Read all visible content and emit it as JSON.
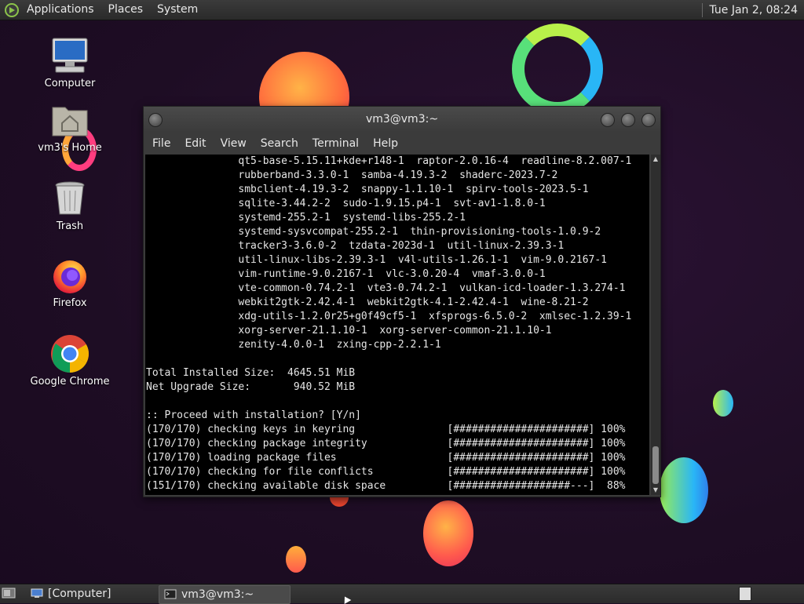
{
  "top_panel": {
    "menus": [
      "Applications",
      "Places",
      "System"
    ],
    "clock": "Tue Jan  2, 08:24"
  },
  "desktop_icons": [
    {
      "label": "Computer",
      "icon": "computer-icon"
    },
    {
      "label": "vm3's Home",
      "icon": "home-folder-icon"
    },
    {
      "label": "Trash",
      "icon": "trash-icon"
    },
    {
      "label": "Firefox",
      "icon": "firefox-icon"
    },
    {
      "label": "Google Chrome",
      "icon": "chrome-icon"
    }
  ],
  "terminal": {
    "title": "vm3@vm3:~",
    "menu": [
      "File",
      "Edit",
      "View",
      "Search",
      "Terminal",
      "Help"
    ],
    "lines": [
      "               qt5-base-5.15.11+kde+r148-1  raptor-2.0.16-4  readline-8.2.007-1",
      "               rubberband-3.3.0-1  samba-4.19.3-2  shaderc-2023.7-2",
      "               smbclient-4.19.3-2  snappy-1.1.10-1  spirv-tools-2023.5-1",
      "               sqlite-3.44.2-2  sudo-1.9.15.p4-1  svt-av1-1.8.0-1",
      "               systemd-255.2-1  systemd-libs-255.2-1",
      "               systemd-sysvcompat-255.2-1  thin-provisioning-tools-1.0.9-2",
      "               tracker3-3.6.0-2  tzdata-2023d-1  util-linux-2.39.3-1",
      "               util-linux-libs-2.39.3-1  v4l-utils-1.26.1-1  vim-9.0.2167-1",
      "               vim-runtime-9.0.2167-1  vlc-3.0.20-4  vmaf-3.0.0-1",
      "               vte-common-0.74.2-1  vte3-0.74.2-1  vulkan-icd-loader-1.3.274-1",
      "               webkit2gtk-2.42.4-1  webkit2gtk-4.1-2.42.4-1  wine-8.21-2",
      "               xdg-utils-1.2.0r25+g0f49cf5-1  xfsprogs-6.5.0-2  xmlsec-1.2.39-1",
      "               xorg-server-21.1.10-1  xorg-server-common-21.1.10-1",
      "               zenity-4.0.0-1  zxing-cpp-2.2.1-1",
      "",
      "Total Installed Size:  4645.51 MiB",
      "Net Upgrade Size:       940.52 MiB",
      "",
      ":: Proceed with installation? [Y/n]",
      "(170/170) checking keys in keyring               [######################] 100%",
      "(170/170) checking package integrity             [######################] 100%",
      "(170/170) loading package files                  [######################] 100%",
      "(170/170) checking for file conflicts            [######################] 100%",
      "(151/170) checking available disk space          [###################---]  88%"
    ]
  },
  "taskbar": {
    "tasks": [
      {
        "label": "[Computer]",
        "icon": "computer-icon"
      },
      {
        "label": "vm3@vm3:~",
        "icon": "terminal-icon"
      }
    ]
  }
}
